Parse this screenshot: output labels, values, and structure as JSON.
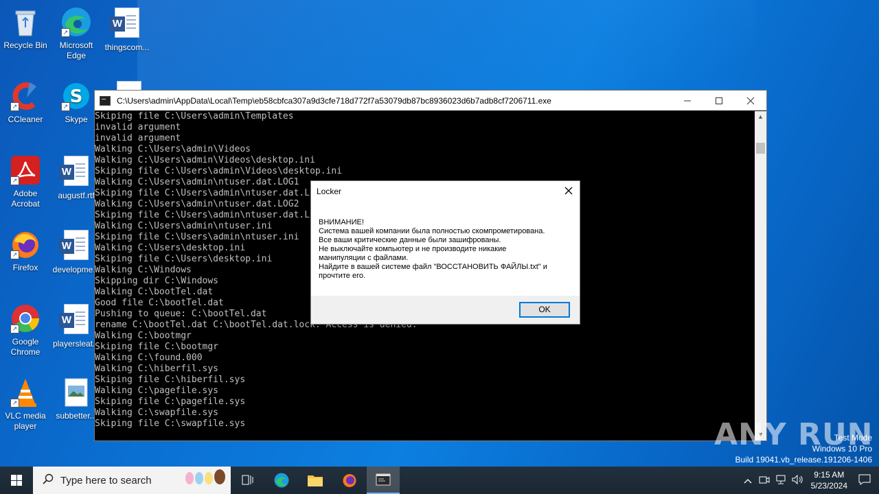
{
  "desktop": {
    "icons": [
      {
        "label": "Recycle Bin",
        "icon": "recycle-bin-icon"
      },
      {
        "label": "Microsoft Edge",
        "icon": "edge-icon"
      },
      {
        "label": "thingscom...",
        "icon": "word-document-icon"
      },
      {
        "label": "CCleaner",
        "icon": "ccleaner-icon"
      },
      {
        "label": "Skype",
        "icon": "skype-icon"
      },
      {
        "label": "Adobe Acrobat",
        "icon": "acrobat-icon"
      },
      {
        "label": "augustf.rtf",
        "icon": "word-document-icon"
      },
      {
        "label": "Firefox",
        "icon": "firefox-icon"
      },
      {
        "label": "developme...",
        "icon": "word-document-icon"
      },
      {
        "label": "Google Chrome",
        "icon": "chrome-icon"
      },
      {
        "label": "playersleat...",
        "icon": "word-document-icon"
      },
      {
        "label": "VLC media player",
        "icon": "vlc-icon"
      },
      {
        "label": "subbetter...",
        "icon": "image-file-icon"
      }
    ]
  },
  "console": {
    "title": "C:\\Users\\admin\\AppData\\Local\\Temp\\eb58cbfca307a9d3cfe718d772f7a53079db87bc8936023d6b7adb8cf7206711.exe",
    "lines": [
      "Skiping file C:\\Users\\admin\\Templates",
      "invalid argument",
      "invalid argument",
      "Walking C:\\Users\\admin\\Videos",
      "Walking C:\\Users\\admin\\Videos\\desktop.ini",
      "Skiping file C:\\Users\\admin\\Videos\\desktop.ini",
      "Walking C:\\Users\\admin\\ntuser.dat.LOG1",
      "Skiping file C:\\Users\\admin\\ntuser.dat.LOG1",
      "Walking C:\\Users\\admin\\ntuser.dat.LOG2",
      "Skiping file C:\\Users\\admin\\ntuser.dat.LOG2",
      "Walking C:\\Users\\admin\\ntuser.ini",
      "Skiping file C:\\Users\\admin\\ntuser.ini",
      "Walking C:\\Users\\desktop.ini",
      "Skiping file C:\\Users\\desktop.ini",
      "Walking C:\\Windows",
      "Skipping dir C:\\Windows",
      "Walking C:\\bootTel.dat",
      "Good file C:\\bootTel.dat",
      "Pushing to queue: C:\\bootTel.dat",
      "rename C:\\bootTel.dat C:\\bootTel.dat.lock: Access is denied.",
      "Walking C:\\bootmgr",
      "Skiping file C:\\bootmgr",
      "Walking C:\\found.000",
      "Walking C:\\hiberfil.sys",
      "Skiping file C:\\hiberfil.sys",
      "Walking C:\\pagefile.sys",
      "Skiping file C:\\pagefile.sys",
      "Walking C:\\swapfile.sys",
      "Skiping file C:\\swapfile.sys"
    ]
  },
  "dialog": {
    "title": "Locker",
    "message_lines": [
      "ВНИМАНИЕ!",
      "Система вашей компании была полностью скомпрометирована.",
      "Все ваши критические данные были зашифрованы.",
      "Не выключайте компьютер и не производите никакие",
      "манипуляции с файлами.",
      "Найдите в вашей системе файл \"ВОССТАНОВИТЬ ФАЙЛЫ.txt\" и",
      "прочтите его."
    ],
    "ok_label": "OK"
  },
  "watermark": {
    "brand": "ANY RUN",
    "line1": "Test Mode",
    "line2": "Windows 10 Pro",
    "line3": "Build 19041.vb_release.191206-1406"
  },
  "taskbar": {
    "search_placeholder": "Type here to search",
    "time": "9:15 AM",
    "date": "5/23/2024"
  }
}
